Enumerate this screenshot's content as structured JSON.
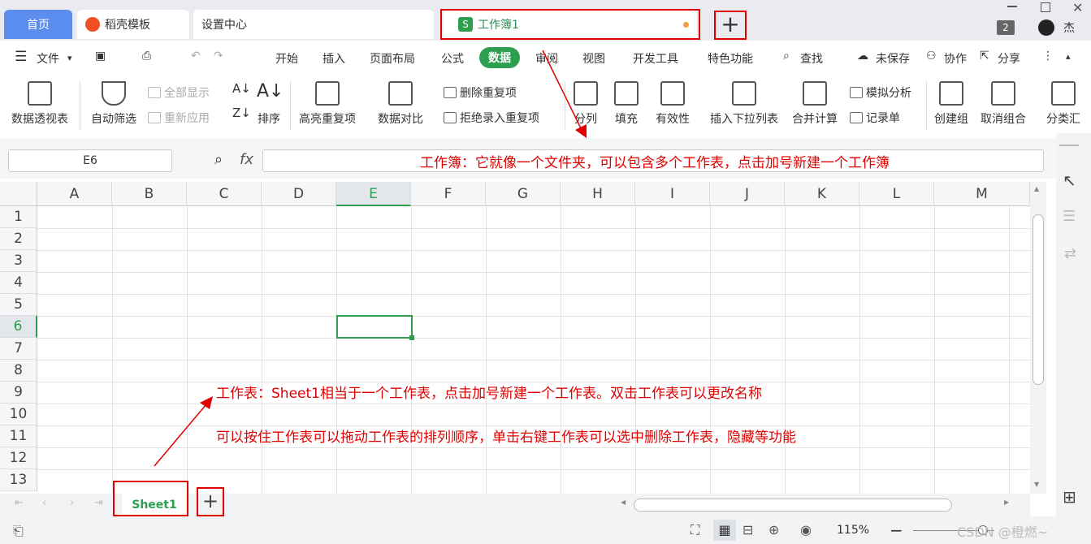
{
  "tabs": {
    "home": "首页",
    "docer": "稻壳模板",
    "settings": "设置中心",
    "workbook": "工作簿1",
    "notif_count": "2",
    "user": "杰"
  },
  "menu": {
    "file": "文件",
    "items": [
      "开始",
      "插入",
      "页面布局",
      "公式",
      "数据",
      "审阅",
      "视图",
      "开发工具",
      "特色功能"
    ],
    "search": "查找",
    "unsaved": "未保存",
    "collab": "协作",
    "share": "分享"
  },
  "ribbon": {
    "pivot": "数据透视表",
    "autofilter": "自动筛选",
    "show_all": "全部显示",
    "reapply": "重新应用",
    "sort": "排序",
    "highlight_dup": "高亮重复项",
    "compare": "数据对比",
    "remove_dup": "删除重复项",
    "reject_dup": "拒绝录入重复项",
    "split": "分列",
    "fill": "填充",
    "validity": "有效性",
    "dropdown": "插入下拉列表",
    "consolidate": "合并计算",
    "whatif": "模拟分析",
    "record": "记录单",
    "group": "创建组",
    "ungroup": "取消组合",
    "subtotal": "分类汇"
  },
  "formula": {
    "cell_ref": "E6",
    "fx": "fx"
  },
  "annotations": {
    "workbook": "工作簿：它就像一个文件夹，可以包含多个工作表，点击加号新建一个工作簿",
    "sheet_line1": "工作表：Sheet1相当于一个工作表，点击加号新建一个工作表。双击工作表可以更改名称",
    "sheet_line2": "可以按住工作表可以拖动工作表的排列顺序，单击右键工作表可以选中删除工作表，隐藏等功能"
  },
  "grid": {
    "columns": [
      "A",
      "B",
      "C",
      "D",
      "E",
      "F",
      "G",
      "H",
      "I",
      "J",
      "K",
      "L",
      "M"
    ],
    "rows": [
      "1",
      "2",
      "3",
      "4",
      "5",
      "6",
      "7",
      "8",
      "9",
      "10",
      "11",
      "12",
      "13"
    ],
    "active_col": "E",
    "active_row": "6"
  },
  "sheets": {
    "active": "Sheet1"
  },
  "status": {
    "zoom": "115%",
    "watermark": "CSDN @橙燃~"
  },
  "colors": {
    "accent": "#2e9f4f",
    "annotation": "#e00000",
    "home_tab": "#5b8def"
  }
}
